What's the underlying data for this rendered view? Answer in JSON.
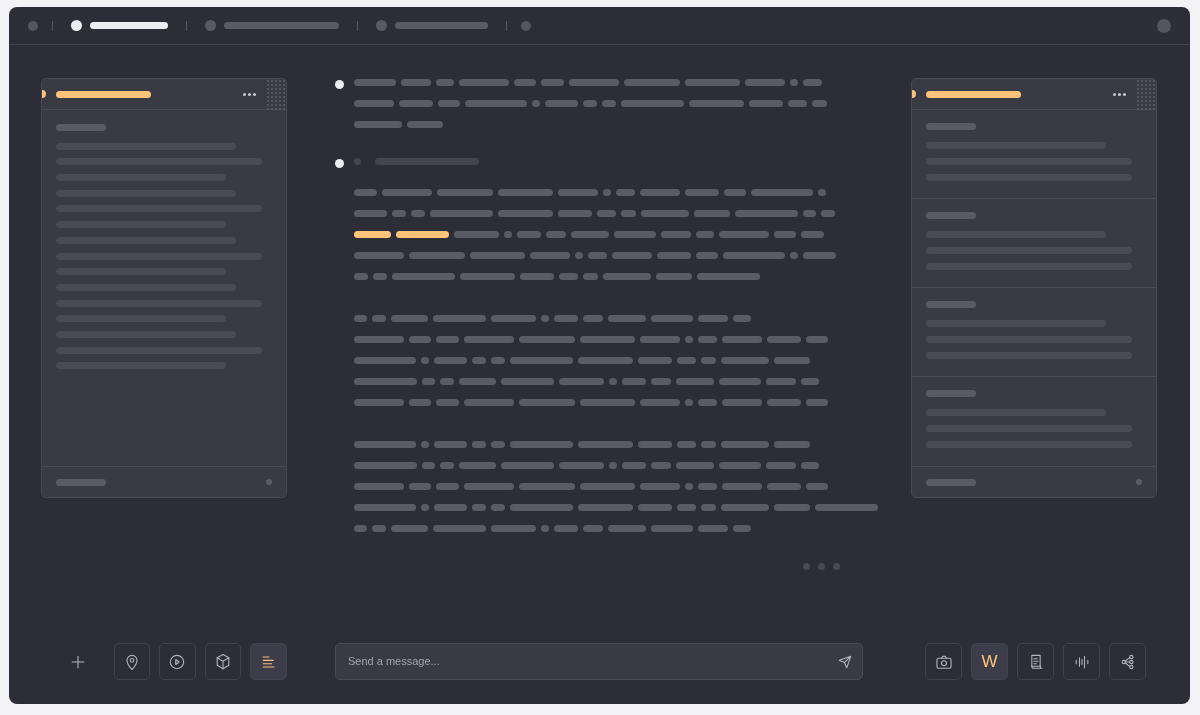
{
  "top_bar": {
    "tabs": [
      {
        "selected": true
      },
      {
        "selected": false
      },
      {
        "selected": false
      }
    ]
  },
  "left_toolbar": [
    {
      "kind": "add",
      "selected": false
    },
    {
      "kind": "location",
      "selected": false
    },
    {
      "kind": "play",
      "selected": false
    },
    {
      "kind": "cube",
      "selected": false
    },
    {
      "kind": "align",
      "selected": true
    }
  ],
  "composer": {
    "placeholder": "Send a message..."
  },
  "right_toolbar": [
    {
      "kind": "camera",
      "selected": false
    },
    {
      "kind": "letter",
      "label": "W",
      "selected": true
    },
    {
      "kind": "document",
      "selected": false
    },
    {
      "kind": "waveform",
      "selected": false
    },
    {
      "kind": "share",
      "selected": false
    }
  ]
}
